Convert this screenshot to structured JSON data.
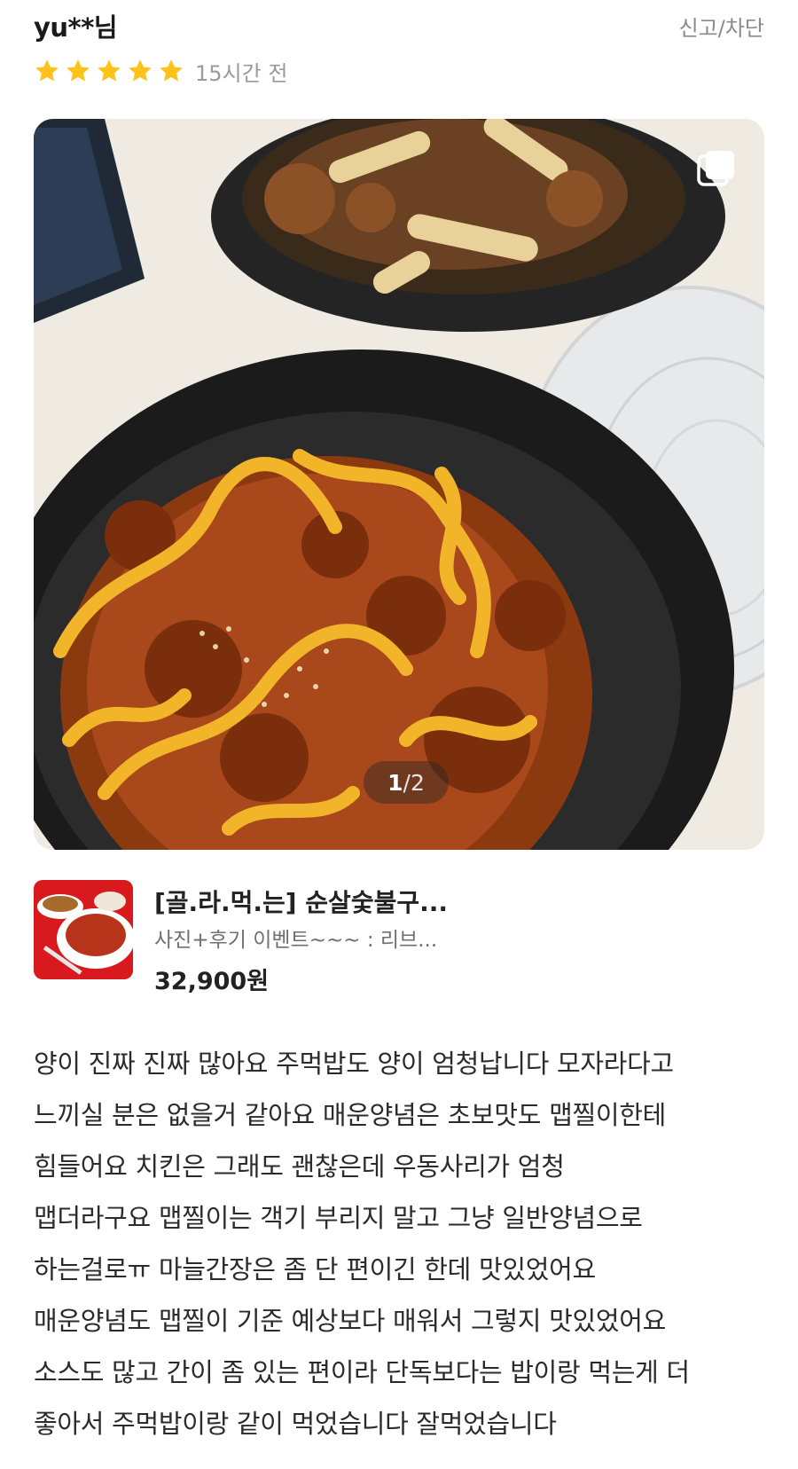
{
  "review": {
    "username": "yu**님",
    "report_label": "신고/차단",
    "rating": 5,
    "rating_max": 5,
    "time_ago": "15시간 전",
    "photo": {
      "current": "1",
      "separator": "/",
      "total": "2",
      "multi_photo_icon": "stacked-images-icon"
    },
    "body_lines": [
      "양이 진짜 진짜 많아요 주먹밥도 양이 엄청납니다 모자라다고",
      "느끼실 분은 없을거 같아요 매운양념은 초보맛도 맵찔이한테",
      "힘들어요 치킨은 그래도 괜찮은데 우동사리가 엄청",
      "맵더라구요 맵찔이는 객기 부리지 말고 그냥 일반양념으로",
      "하는걸로ㅠ 마늘간장은 좀 단 편이긴 한데 맛있었어요",
      "매운양념도 맵찔이 기준 예상보다 매워서 그렇지 맛있었어요",
      "소스도 많고 간이 좀 있는 편이라 단독보다는 밥이랑 먹는게 더",
      "좋아서 주먹밥이랑 같이 먹었습니다 잘먹었습니다"
    ]
  },
  "product": {
    "name": "[골.라.먹.는] 순살숯불구...",
    "description": "사진+후기 이벤트~~~ : 리브...",
    "price": "32,900원"
  },
  "colors": {
    "star": "#FFC21A",
    "report_text": "#8A8A8A",
    "muted_text": "#9A9A9A"
  }
}
